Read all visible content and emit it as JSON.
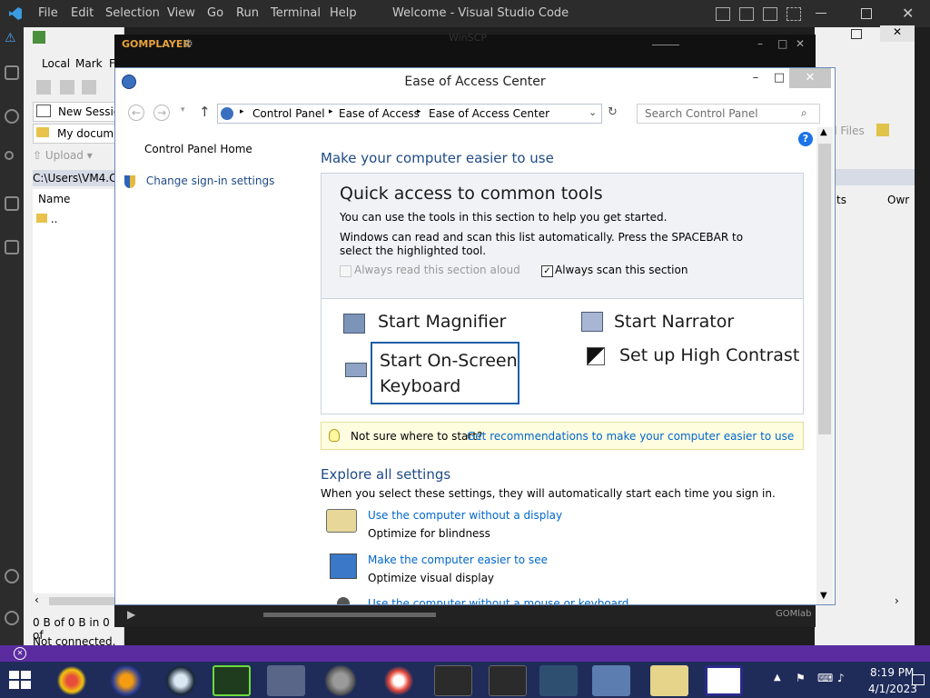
{
  "vscode": {
    "menu": [
      "File",
      "Edit",
      "Selection",
      "View",
      "Go",
      "Run",
      "Terminal",
      "Help"
    ],
    "title": "Welcome - Visual Studio Code"
  },
  "winscp": {
    "menu": [
      "Local",
      "Mark",
      "F"
    ],
    "new_session": "New Sessio",
    "my_documents": "My docum",
    "upload": "Upload",
    "path": "C:\\Users\\VM4.C",
    "col_name": "Name",
    "parent_dir": "..",
    "status_bytes": "0 B of 0 B in 0 of",
    "status_conn": "Not connected."
  },
  "bg_window": {
    "files_label": "d Files",
    "col_rights": "ts",
    "col_owner": "Owr"
  },
  "gom": {
    "title": "GOMPLAYER",
    "partial_title": "WinSCP",
    "brand": "GOMlab"
  },
  "eoa": {
    "title": "Ease of Access Center",
    "breadcrumb": [
      "Control Panel",
      "Ease of Access",
      "Ease of Access Center"
    ],
    "search_placeholder": "Search Control Panel",
    "sidebar": {
      "home": "Control Panel Home",
      "signin": "Change sign-in settings"
    },
    "heading": "Make your computer easier to use",
    "quick": {
      "title": "Quick access to common tools",
      "desc1": "You can use the tools in this section to help you get started.",
      "desc2": "Windows can read and scan this list automatically.  Press the SPACEBAR to select the highlighted tool.",
      "read_aloud": "Always read this section aloud",
      "scan": "Always scan this section",
      "read_aloud_checked": false,
      "scan_checked": true
    },
    "tools": {
      "magnifier": "Start Magnifier",
      "narrator": "Start Narrator",
      "osk_line1": "Start On-Screen",
      "osk_line2": "Keyboard",
      "contrast": "Set up High Contrast"
    },
    "hint": {
      "prefix": "Not sure where to start?",
      "link": "Get recommendations to make your computer easier to use"
    },
    "explore": {
      "heading": "Explore all settings",
      "desc": "When you select these settings, they will automatically start each time you sign in.",
      "items": [
        {
          "link": "Use the computer without a display",
          "sub": "Optimize for blindness"
        },
        {
          "link": "Make the computer easier to see",
          "sub": "Optimize visual display"
        },
        {
          "link": "Use the computer without a mouse or keyboard",
          "sub": ""
        }
      ]
    }
  },
  "taskbar": {
    "time": "8:19 PM",
    "date": "4/1/2023"
  },
  "colors": {
    "link": "#0066cc",
    "heading": "#1f4a86",
    "taskbar": "#1f2c5a",
    "vscode_status": "#5a2ca0"
  }
}
